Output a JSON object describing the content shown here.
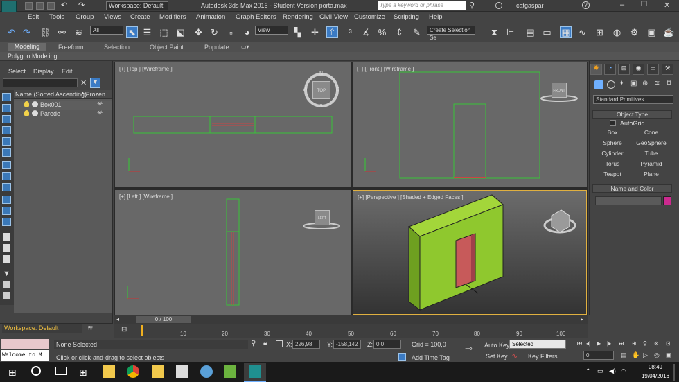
{
  "title_bar": {
    "workspace": "Workspace: Default",
    "app_title": "Autodesk 3ds Max 2016 - Student Version    porta.max",
    "search_placeholder": "Type a keyword or phrase",
    "user": "catgaspar",
    "max_logo": "MAX"
  },
  "menu": [
    "Edit",
    "Tools",
    "Group",
    "Views",
    "Create",
    "Modifiers",
    "Animation",
    "Graph Editors",
    "Rendering",
    "Civil View",
    "Customize",
    "Scripting",
    "Help"
  ],
  "toolbar": {
    "selection_filter": "All",
    "coord_system": "View",
    "named_selection": "Create Selection Se"
  },
  "ribbon": {
    "tabs": [
      "Modeling",
      "Freeform",
      "Selection",
      "Object Paint",
      "Populate"
    ],
    "active_tab": "Modeling",
    "sub_label": "Polygon Modeling"
  },
  "scene_explorer": {
    "menu": [
      "Select",
      "Display",
      "Edit"
    ],
    "col_name": "Name (Sorted Ascending)",
    "col_frozen": "Frozen",
    "sort_arrow": "▲",
    "rows": [
      {
        "name": "Box001",
        "frozen_icon": "✳"
      },
      {
        "name": "Parede",
        "frozen_icon": "✳"
      }
    ],
    "workspace_footer": "Workspace: Default"
  },
  "viewports": {
    "top": "[+] [Top ] [Wireframe ]",
    "front": "[+] [Front ] [Wireframe ]",
    "left": "[+] [Left ] [Wireframe ]",
    "perspective": "[+] [Perspective ] [Shaded + Edged Faces ]",
    "viewcube_top": "TOP",
    "viewcube_front": "FRONT",
    "viewcube_left": "LEFT",
    "compass": {
      "n": "N",
      "s": "S",
      "e": "E",
      "w": "W"
    }
  },
  "command_panel": {
    "category": "Standard Primitives",
    "object_type_title": "Object Type",
    "autogrid": "AutoGrid",
    "buttons": [
      "Box",
      "Cone",
      "Sphere",
      "GeoSphere",
      "Cylinder",
      "Tube",
      "Torus",
      "Pyramid",
      "Teapot",
      "Plane"
    ],
    "name_color_title": "Name and Color",
    "object_color": "#cc2a8f"
  },
  "timeline": {
    "frame_display": "0 / 100",
    "ticks": [
      "10",
      "20",
      "30",
      "40",
      "50",
      "60",
      "70",
      "80",
      "90",
      "100"
    ]
  },
  "status": {
    "maxscript_text": "Welcome to M",
    "selection": "None Selected",
    "prompt": "Click or click-and-drag to select objects",
    "x_label": "X:",
    "x_value": "226,98",
    "y_label": "Y:",
    "y_value": "-158,142",
    "z_label": "Z:",
    "z_value": "0,0",
    "grid": "Grid = 100,0",
    "add_time_tag": "Add Time Tag",
    "auto_key": "Auto Key",
    "set_key": "Set Key",
    "key_mode": "Selected",
    "key_filters": "Key Filters...",
    "current_frame": "0"
  },
  "taskbar": {
    "time": "08:49",
    "date": "19/04/2016"
  }
}
